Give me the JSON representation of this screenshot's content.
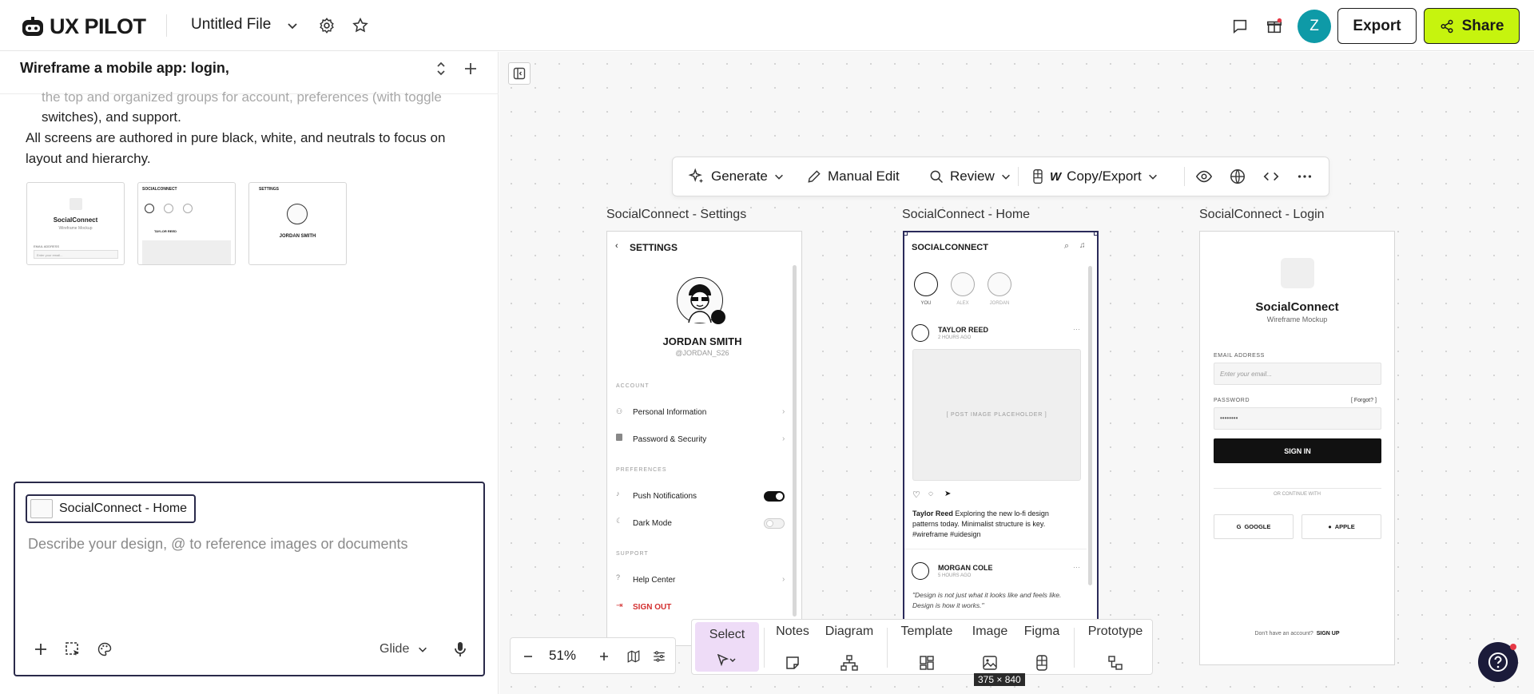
{
  "app": {
    "name": "UX PILOT",
    "file_name": "Untitled File",
    "user_initial": "Z",
    "export_label": "Export",
    "share_label": "Share",
    "accent": "#c6f40e"
  },
  "chat": {
    "title": "Wireframe a mobile app: login,",
    "faded_text": "the top and organized groups for account, preferences (with toggle",
    "para_1_line_2": "switches), and support.",
    "para_2": "All screens are authored in pure black, white, and neutrals to focus on layout and hierarchy.",
    "thumbs": [
      {
        "title": "SocialConnect",
        "sub": "Wireframe Mockup",
        "label": "EMAIL ADDRESS",
        "field": "Enter your email..."
      },
      {
        "title": "SOCIALCONNECT",
        "poster": "TAYLOR REED"
      },
      {
        "title": "SETTINGS",
        "name": "JORDAN SMITH"
      }
    ]
  },
  "composer": {
    "chip_label": "SocialConnect - Home",
    "placeholder": "Describe your design, @ to reference images or documents",
    "model": "Glide"
  },
  "toolbar": {
    "generate": "Generate",
    "manual_edit": "Manual Edit",
    "review": "Review",
    "copy_export": "Copy/Export"
  },
  "frames": {
    "settings": {
      "label": "SocialConnect - Settings",
      "header": "SETTINGS",
      "name": "JORDAN SMITH",
      "handle": "@JORDAN_S26",
      "section_account": "ACCOUNT",
      "personal_info": "Personal Information",
      "password_security": "Password & Security",
      "section_preferences": "PREFERENCES",
      "push_notifications": "Push Notifications",
      "dark_mode": "Dark Mode",
      "section_support": "SUPPORT",
      "help_center": "Help Center",
      "sign_out": "SIGN OUT"
    },
    "home": {
      "label": "SocialConnect - Home",
      "header": "SOCIALCONNECT",
      "stories": [
        "YOU",
        "ALEX",
        "JORDAN"
      ],
      "post1_author": "TAYLOR REED",
      "post1_time": "2 HOURS AGO",
      "image_placeholder": "[ POST IMAGE PLACEHOLDER ]",
      "post1_caption_author": "Taylor Reed",
      "post1_caption": "Exploring the new lo-fi design patterns today. Minimalist structure is key. #wireframe #uidesign",
      "post2_author": "MORGAN COLE",
      "post2_time": "5 HOURS AGO",
      "post2_quote": "\"Design is not just what it looks like and feels like. Design is how it works.\""
    },
    "login": {
      "label": "SocialConnect - Login",
      "title": "SocialConnect",
      "subtitle": "Wireframe Mockup",
      "email_label": "EMAIL ADDRESS",
      "email_placeholder": "Enter your email...",
      "password_label": "PASSWORD",
      "forgot": "[ Forgot? ]",
      "password_value": "••••••••",
      "sign_in": "SIGN IN",
      "or_continue": "OR CONTINUE WITH",
      "google": "GOOGLE",
      "apple": "APPLE",
      "no_account": "Don't have an account?",
      "sign_up": "SIGN UP"
    }
  },
  "bottombar": {
    "select": "Select",
    "notes": "Notes",
    "diagram": "Diagram",
    "template": "Template",
    "image": "Image",
    "figma": "Figma",
    "prototype": "Prototype"
  },
  "zoom": {
    "value": "51%"
  },
  "selection_size": "375 × 840"
}
